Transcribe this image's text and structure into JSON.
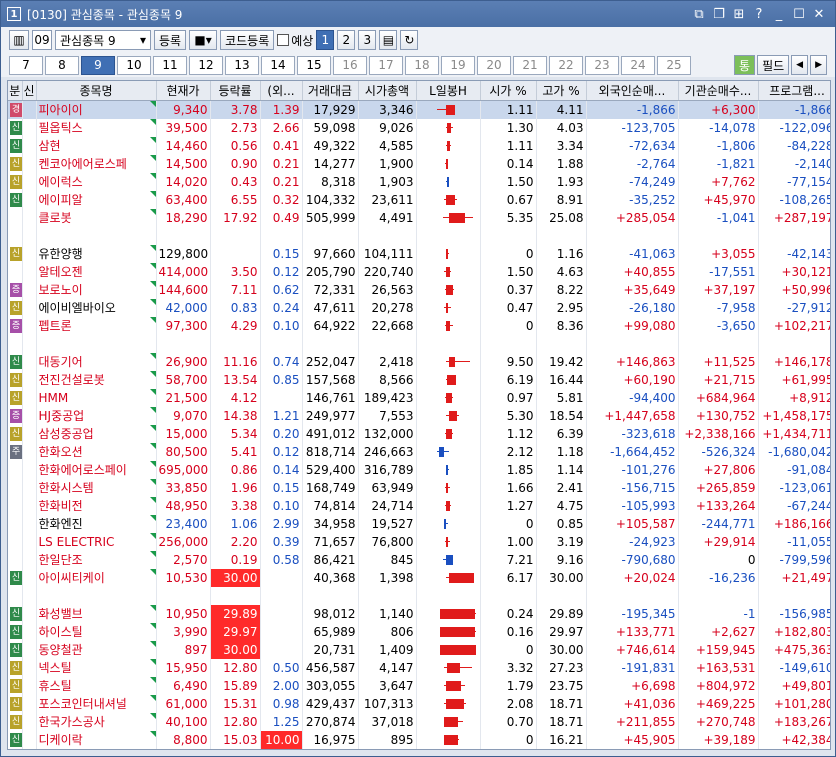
{
  "window": {
    "title": "[0130] 관심종목 - 관심종목 9",
    "app_icon": "1"
  },
  "toolbar": {
    "group_no": "09",
    "group_name": "관심종목 9",
    "register": "등록",
    "code_register": "코드등록",
    "reserve": "예상",
    "pages": [
      "1",
      "2",
      "3"
    ],
    "active_page": "1"
  },
  "tabs": {
    "items": [
      "7",
      "8",
      "9",
      "10",
      "11",
      "12",
      "13",
      "14",
      "15",
      "16",
      "17",
      "18",
      "19",
      "20",
      "21",
      "22",
      "23",
      "24",
      "25"
    ],
    "active": "9",
    "dim_from": "16",
    "right_btns": [
      "통",
      "필드"
    ]
  },
  "columns": [
    "분",
    "신",
    "종목명",
    "현재가",
    "등락률",
    "(외...",
    "거래대금",
    "시가총액",
    "L일봉H",
    "시가 %",
    "고가 %",
    "외국인순매...",
    "기관순매수...",
    "프로그램..."
  ],
  "colors": {
    "up": "#d6001c",
    "down": "#1a4fc0",
    "highlight": "#ff2a2a"
  },
  "rows": [
    {
      "b": "경",
      "bc": "b-gyeong",
      "name": "피아이이",
      "c": "up",
      "price": "9,340",
      "rate": "3.78",
      "fx": "1.39",
      "vol": "17,929",
      "cap": "3,346",
      "open": "1.11",
      "high": "4.11",
      "fore": "-1,866",
      "inst": "+6,300",
      "prog": "-1,866",
      "sel": true,
      "k": [
        0.3,
        0.55,
        0.45,
        0.6,
        "up"
      ]
    },
    {
      "b": "신",
      "bc": "b-sin",
      "name": "필옵틱스",
      "c": "up",
      "price": "39,500",
      "rate": "2.73",
      "fx": "2.66",
      "vol": "59,098",
      "cap": "9,026",
      "open": "1.30",
      "high": "4.03",
      "fore": "-123,705",
      "inst": "-14,078",
      "prog": "-122,096",
      "k": [
        0.45,
        0.58,
        0.48,
        0.55,
        "up"
      ]
    },
    {
      "b": "신",
      "bc": "b-sin",
      "name": "삼현",
      "c": "up",
      "price": "14,460",
      "rate": "0.56",
      "fx": "0.41",
      "vol": "49,322",
      "cap": "4,585",
      "open": "1.11",
      "high": "3.34",
      "fore": "-72,634",
      "inst": "-1,806",
      "prog": "-84,228",
      "k": [
        0.46,
        0.55,
        0.48,
        0.52,
        "up"
      ]
    },
    {
      "b": "신",
      "bc": "b-yellow",
      "name": "켄코아에어로스페",
      "c": "up",
      "price": "14,500",
      "rate": "0.90",
      "fx": "0.21",
      "vol": "14,277",
      "cap": "1,900",
      "open": "0.14",
      "high": "1.88",
      "fore": "-2,764",
      "inst": "-1,821",
      "prog": "-2,140",
      "k": [
        0.44,
        0.5,
        0.46,
        0.49,
        "up"
      ]
    },
    {
      "b": "신",
      "bc": "b-yellow",
      "name": "에이럭스",
      "c": "up",
      "price": "14,020",
      "rate": "0.43",
      "fx": "0.21",
      "vol": "8,318",
      "cap": "1,903",
      "open": "1.50",
      "high": "1.93",
      "fore": "-74,249",
      "inst": "+7,762",
      "prog": "-77,154",
      "k": [
        0.45,
        0.5,
        0.47,
        0.49,
        "dn"
      ]
    },
    {
      "b": "신",
      "bc": "b-sin",
      "name": "에이피알",
      "c": "up",
      "price": "63,400",
      "rate": "6.55",
      "fx": "0.32",
      "vol": "104,332",
      "cap": "23,611",
      "open": "0.67",
      "high": "8.91",
      "fore": "-35,252",
      "inst": "+45,970",
      "prog": "-108,265",
      "k": [
        0.42,
        0.65,
        0.45,
        0.6,
        "up"
      ]
    },
    {
      "b": "",
      "bc": "",
      "name": "클로봇",
      "c": "up",
      "price": "18,290",
      "rate": "17.92",
      "fx": "0.49",
      "vol": "505,999",
      "cap": "4,491",
      "open": "5.35",
      "high": "25.08",
      "fore": "+285,054",
      "inst": "-1,041",
      "prog": "+287,197",
      "k": [
        0.4,
        0.9,
        0.5,
        0.78,
        "up"
      ]
    },
    {
      "blank": true
    },
    {
      "b": "신",
      "bc": "b-yellow",
      "name": "유한양행",
      "c": "",
      "price": "129,800",
      "rate": "",
      "fx": "0.15",
      "vol": "97,660",
      "cap": "104,111",
      "open": "0",
      "high": "1.16",
      "fore": "-41,063",
      "inst": "+3,055",
      "prog": "-42,143",
      "k": [
        0.45,
        0.5,
        0.46,
        0.47,
        "up"
      ]
    },
    {
      "b": "",
      "bc": "",
      "name": "알테오젠",
      "c": "up",
      "price": "414,000",
      "rate": "3.50",
      "fx": "0.12",
      "vol": "205,790",
      "cap": "220,740",
      "open": "1.50",
      "high": "4.63",
      "fore": "+40,855",
      "inst": "-17,551",
      "prog": "+30,121",
      "k": [
        0.42,
        0.55,
        0.45,
        0.52,
        "up"
      ]
    },
    {
      "b": "증",
      "bc": "b-jeung",
      "name": "보로노이",
      "c": "up",
      "price": "144,600",
      "rate": "7.11",
      "fx": "0.62",
      "vol": "72,331",
      "cap": "26,563",
      "open": "0.37",
      "high": "8.22",
      "fore": "+35,649",
      "inst": "+37,197",
      "prog": "+50,996",
      "k": [
        0.44,
        0.6,
        0.46,
        0.58,
        "up"
      ]
    },
    {
      "b": "신",
      "bc": "b-yellow",
      "name": "에이비엘바이오",
      "c": "dn",
      "price": "42,000",
      "rate": "0.83",
      "fx": "0.24",
      "vol": "47,611",
      "cap": "20,278",
      "open": "0.47",
      "high": "2.95",
      "fore": "-26,180",
      "inst": "-7,958",
      "prog": "-27,912",
      "k": [
        0.42,
        0.54,
        0.45,
        0.48,
        "up"
      ]
    },
    {
      "b": "증",
      "bc": "b-jeung",
      "name": "펩트론",
      "c": "up",
      "price": "97,300",
      "rate": "4.29",
      "fx": "0.10",
      "vol": "64,922",
      "cap": "22,668",
      "open": "0",
      "high": "8.36",
      "fore": "+99,080",
      "inst": "-3,650",
      "prog": "+102,217",
      "k": [
        0.44,
        0.58,
        0.46,
        0.52,
        "up"
      ]
    },
    {
      "blank": true
    },
    {
      "b": "신",
      "bc": "b-sin",
      "name": "대동기어",
      "c": "up",
      "price": "26,900",
      "rate": "11.16",
      "fx": "0.74",
      "vol": "252,047",
      "cap": "2,418",
      "open": "9.50",
      "high": "19.42",
      "fore": "+146,863",
      "inst": "+11,525",
      "prog": "+146,178",
      "k": [
        0.45,
        0.85,
        0.5,
        0.6,
        "up"
      ]
    },
    {
      "b": "신",
      "bc": "b-yellow",
      "name": "전진건설로봇",
      "c": "up",
      "price": "58,700",
      "rate": "13.54",
      "fx": "0.85",
      "vol": "157,568",
      "cap": "8,566",
      "open": "6.19",
      "high": "16.44",
      "fore": "+60,190",
      "inst": "+21,715",
      "prog": "+61,995",
      "k": [
        0.45,
        0.62,
        0.48,
        0.62,
        "up"
      ]
    },
    {
      "b": "신",
      "bc": "b-yellow",
      "name": "HMM",
      "c": "up",
      "price": "21,500",
      "rate": "4.12",
      "fx": "",
      "vol": "146,761",
      "cap": "189,423",
      "open": "0.97",
      "high": "5.81",
      "fore": "-94,400",
      "inst": "+684,964",
      "prog": "+8,912",
      "k": [
        0.44,
        0.58,
        0.46,
        0.56,
        "up"
      ]
    },
    {
      "b": "증",
      "bc": "b-jeung",
      "name": "HJ중공업",
      "c": "up",
      "price": "9,070",
      "rate": "14.38",
      "fx": "1.21",
      "vol": "249,977",
      "cap": "7,553",
      "open": "5.30",
      "high": "18.54",
      "fore": "+1,447,658",
      "inst": "+130,752",
      "prog": "+1,458,175",
      "k": [
        0.45,
        0.68,
        0.5,
        0.64,
        "up"
      ]
    },
    {
      "b": "신",
      "bc": "b-yellow",
      "name": "삼성중공업",
      "c": "up",
      "price": "15,000",
      "rate": "5.34",
      "fx": "0.20",
      "vol": "491,012",
      "cap": "132,000",
      "open": "1.12",
      "high": "6.39",
      "fore": "-323,618",
      "inst": "+2,338,166",
      "prog": "+1,434,711",
      "k": [
        0.44,
        0.58,
        0.46,
        0.56,
        "up"
      ]
    },
    {
      "b": "주",
      "bc": "b-ju",
      "name": "한화오션",
      "c": "up",
      "price": "80,500",
      "rate": "5.41",
      "fx": "0.12",
      "vol": "818,714",
      "cap": "246,663",
      "open": "2.12",
      "high": "1.18",
      "fore": "-1,664,452",
      "inst": "-526,324",
      "prog": "-1,680,042",
      "k": [
        0.3,
        0.5,
        0.34,
        0.42,
        "dn"
      ]
    },
    {
      "b": "",
      "bc": "",
      "name": "한화에어로스페이",
      "c": "up",
      "price": "695,000",
      "rate": "0.86",
      "fx": "0.14",
      "vol": "529,400",
      "cap": "316,789",
      "open": "1.85",
      "high": "1.14",
      "fore": "-101,276",
      "inst": "+27,806",
      "prog": "-91,084",
      "k": [
        0.45,
        0.5,
        0.46,
        0.49,
        "dn"
      ]
    },
    {
      "b": "",
      "bc": "",
      "name": "한화시스템",
      "c": "up",
      "price": "33,850",
      "rate": "1.96",
      "fx": "0.15",
      "vol": "168,749",
      "cap": "63,949",
      "open": "1.66",
      "high": "2.41",
      "fore": "-156,715",
      "inst": "+265,859",
      "prog": "-123,061",
      "k": [
        0.44,
        0.52,
        0.46,
        0.5,
        "up"
      ]
    },
    {
      "b": "",
      "bc": "",
      "name": "한화비전",
      "c": "up",
      "price": "48,950",
      "rate": "3.38",
      "fx": "0.10",
      "vol": "74,814",
      "cap": "24,714",
      "open": "1.27",
      "high": "4.75",
      "fore": "-105,993",
      "inst": "+133,264",
      "prog": "-67,244",
      "k": [
        0.44,
        0.55,
        0.46,
        0.52,
        "up"
      ]
    },
    {
      "b": "",
      "bc": "",
      "name": "한화엔진",
      "c": "dn",
      "price": "23,400",
      "rate": "1.06",
      "fx": "2.99",
      "vol": "34,958",
      "cap": "19,527",
      "open": "0",
      "high": "0.85",
      "fore": "+105,587",
      "inst": "-244,771",
      "prog": "+186,166",
      "k": [
        0.42,
        0.5,
        0.43,
        0.46,
        "dn"
      ]
    },
    {
      "b": "",
      "bc": "",
      "name": "LS ELECTRIC",
      "c": "up",
      "price": "256,000",
      "rate": "2.20",
      "fx": "0.39",
      "vol": "71,657",
      "cap": "76,800",
      "open": "1.00",
      "high": "3.19",
      "fore": "-24,923",
      "inst": "+29,914",
      "prog": "-11,055",
      "k": [
        0.44,
        0.52,
        0.46,
        0.5,
        "up"
      ]
    },
    {
      "b": "",
      "bc": "",
      "name": "한일단조",
      "c": "up",
      "price": "2,570",
      "rate": "0.19",
      "fx": "0.58",
      "vol": "86,421",
      "cap": "845",
      "open": "7.21",
      "high": "9.16",
      "fore": "-790,680",
      "inst": "0",
      "prog": "-799,596",
      "k": [
        0.4,
        0.58,
        0.45,
        0.58,
        "dn"
      ]
    },
    {
      "b": "신",
      "bc": "b-sin",
      "name": "아이씨티케이",
      "c": "up",
      "price": "10,530",
      "rate": "30.00",
      "rate_hl": true,
      "fx": "",
      "vol": "40,368",
      "cap": "1,398",
      "open": "6.17",
      "high": "30.00",
      "fore": "+20,024",
      "inst": "-16,236",
      "prog": "+21,497",
      "k": [
        0.45,
        0.92,
        0.5,
        0.92,
        "up"
      ]
    },
    {
      "blank": true
    },
    {
      "b": "신",
      "bc": "b-sin",
      "name": "화성밸브",
      "c": "up",
      "price": "10,950",
      "rate": "29.89",
      "rate_hl": true,
      "fx": "",
      "vol": "98,012",
      "cap": "1,140",
      "open": "0.24",
      "high": "29.89",
      "fore": "-195,345",
      "inst": "-1",
      "prog": "-156,985",
      "k": [
        0.35,
        0.95,
        0.36,
        0.95,
        "up"
      ]
    },
    {
      "b": "신",
      "bc": "b-sin",
      "name": "하이스틸",
      "c": "up",
      "price": "3,990",
      "rate": "29.97",
      "rate_hl": true,
      "fx": "",
      "vol": "65,989",
      "cap": "806",
      "open": "0.16",
      "high": "29.97",
      "fore": "+133,771",
      "inst": "+2,627",
      "prog": "+182,803",
      "k": [
        0.35,
        0.95,
        0.36,
        0.95,
        "up"
      ]
    },
    {
      "b": "신",
      "bc": "b-sin",
      "name": "동양철관",
      "c": "up",
      "price": "897",
      "rate": "30.00",
      "rate_hl": true,
      "fx": "",
      "vol": "20,731",
      "cap": "1,409",
      "open": "0",
      "high": "30.00",
      "fore": "+746,614",
      "inst": "+159,945",
      "prog": "+475,363",
      "k": [
        0.35,
        0.95,
        0.35,
        0.95,
        "up"
      ]
    },
    {
      "b": "신",
      "bc": "b-yellow",
      "name": "넥스틸",
      "c": "up",
      "price": "15,950",
      "rate": "12.80",
      "fx": "0.50",
      "vol": "456,587",
      "cap": "4,147",
      "open": "3.32",
      "high": "27.23",
      "fore": "-191,831",
      "inst": "+163,531",
      "prog": "-149,610",
      "k": [
        0.42,
        0.9,
        0.48,
        0.7,
        "up"
      ]
    },
    {
      "b": "신",
      "bc": "b-yellow",
      "name": "휴스틸",
      "c": "up",
      "price": "6,490",
      "rate": "15.89",
      "fx": "2.00",
      "vol": "303,055",
      "cap": "3,647",
      "open": "1.79",
      "high": "23.75",
      "fore": "+6,698",
      "inst": "+804,972",
      "prog": "+49,801",
      "k": [
        0.42,
        0.78,
        0.45,
        0.7,
        "up"
      ]
    },
    {
      "b": "신",
      "bc": "b-yellow",
      "name": "포스코인터내셔널",
      "c": "up",
      "price": "61,000",
      "rate": "15.31",
      "fx": "0.98",
      "vol": "429,437",
      "cap": "107,313",
      "open": "2.08",
      "high": "18.71",
      "fore": "+41,036",
      "inst": "+469,225",
      "prog": "+101,280",
      "k": [
        0.42,
        0.8,
        0.45,
        0.76,
        "up"
      ]
    },
    {
      "b": "신",
      "bc": "b-yellow",
      "name": "한국가스공사",
      "c": "up",
      "price": "40,100",
      "rate": "12.80",
      "fx": "1.25",
      "vol": "270,874",
      "cap": "37,018",
      "open": "0.70",
      "high": "18.71",
      "fore": "+211,855",
      "inst": "+270,748",
      "prog": "+183,267",
      "k": [
        0.42,
        0.75,
        0.43,
        0.66,
        "up"
      ]
    },
    {
      "b": "신",
      "bc": "b-sin",
      "name": "디케이락",
      "c": "up",
      "price": "8,800",
      "rate": "15.03",
      "fx": "10.00",
      "fx_hl": true,
      "vol": "16,975",
      "cap": "895",
      "open": "0",
      "high": "16.21",
      "fore": "+45,905",
      "inst": "+39,189",
      "prog": "+42,384",
      "k": [
        0.42,
        0.68,
        0.42,
        0.66,
        "up"
      ]
    }
  ]
}
